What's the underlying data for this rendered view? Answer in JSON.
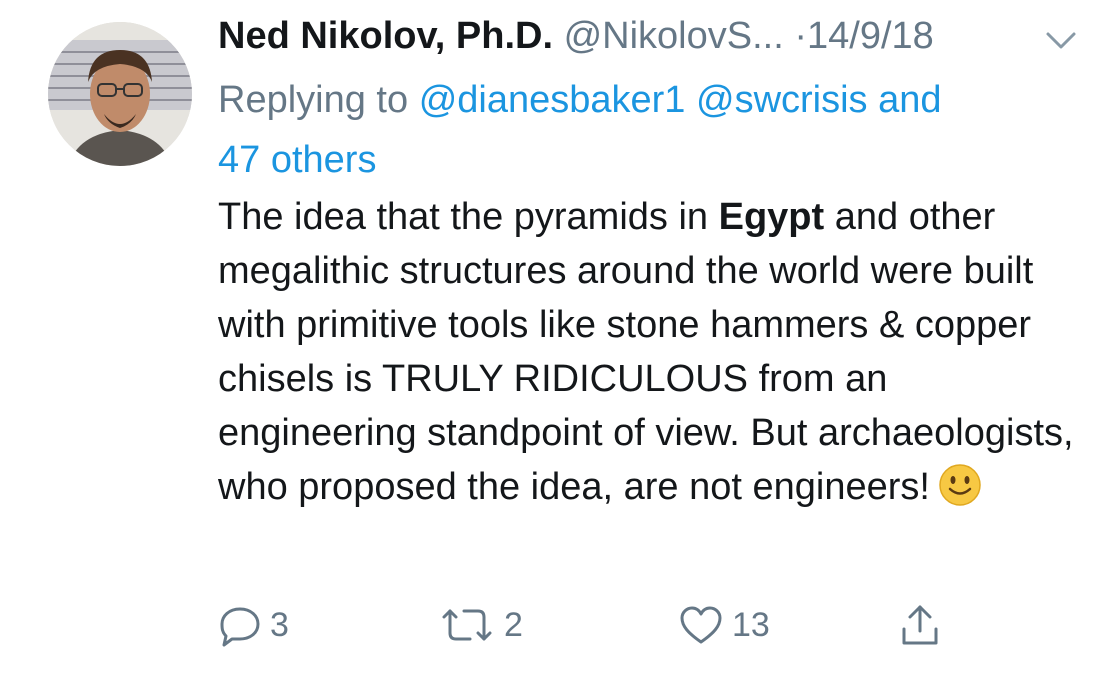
{
  "tweet": {
    "author_name": "Ned Nikolov, Ph.D.",
    "handle": "@NikolovS...",
    "separator": "·",
    "date": "14/9/18",
    "reply_prefix": "Replying to",
    "reply_mentions": [
      "@dianesbaker1",
      "@swcrisis",
      "and",
      "47 others"
    ],
    "body": {
      "part1": "The idea that the pyramids in ",
      "bold": "Egypt",
      "part2": " and other megalithic structures around the world were built with primitive tools like stone hammers & copper chisels is TRULY RIDICULOUS from an engineering standpoint of view. But archaeologists, who proposed the idea, are not engineers!"
    },
    "emoji": "slightly-smiling-face"
  },
  "actions": {
    "reply_count": "3",
    "retweet_count": "2",
    "like_count": "13"
  },
  "icons": {
    "reply": "reply-icon",
    "retweet": "retweet-icon",
    "like": "heart-icon",
    "share": "share-icon",
    "menu": "chevron-down-icon"
  },
  "colors": {
    "link": "#1b95e0",
    "secondary_text": "#657786",
    "primary_text": "#14171a",
    "emoji_face": "#f7c843"
  }
}
